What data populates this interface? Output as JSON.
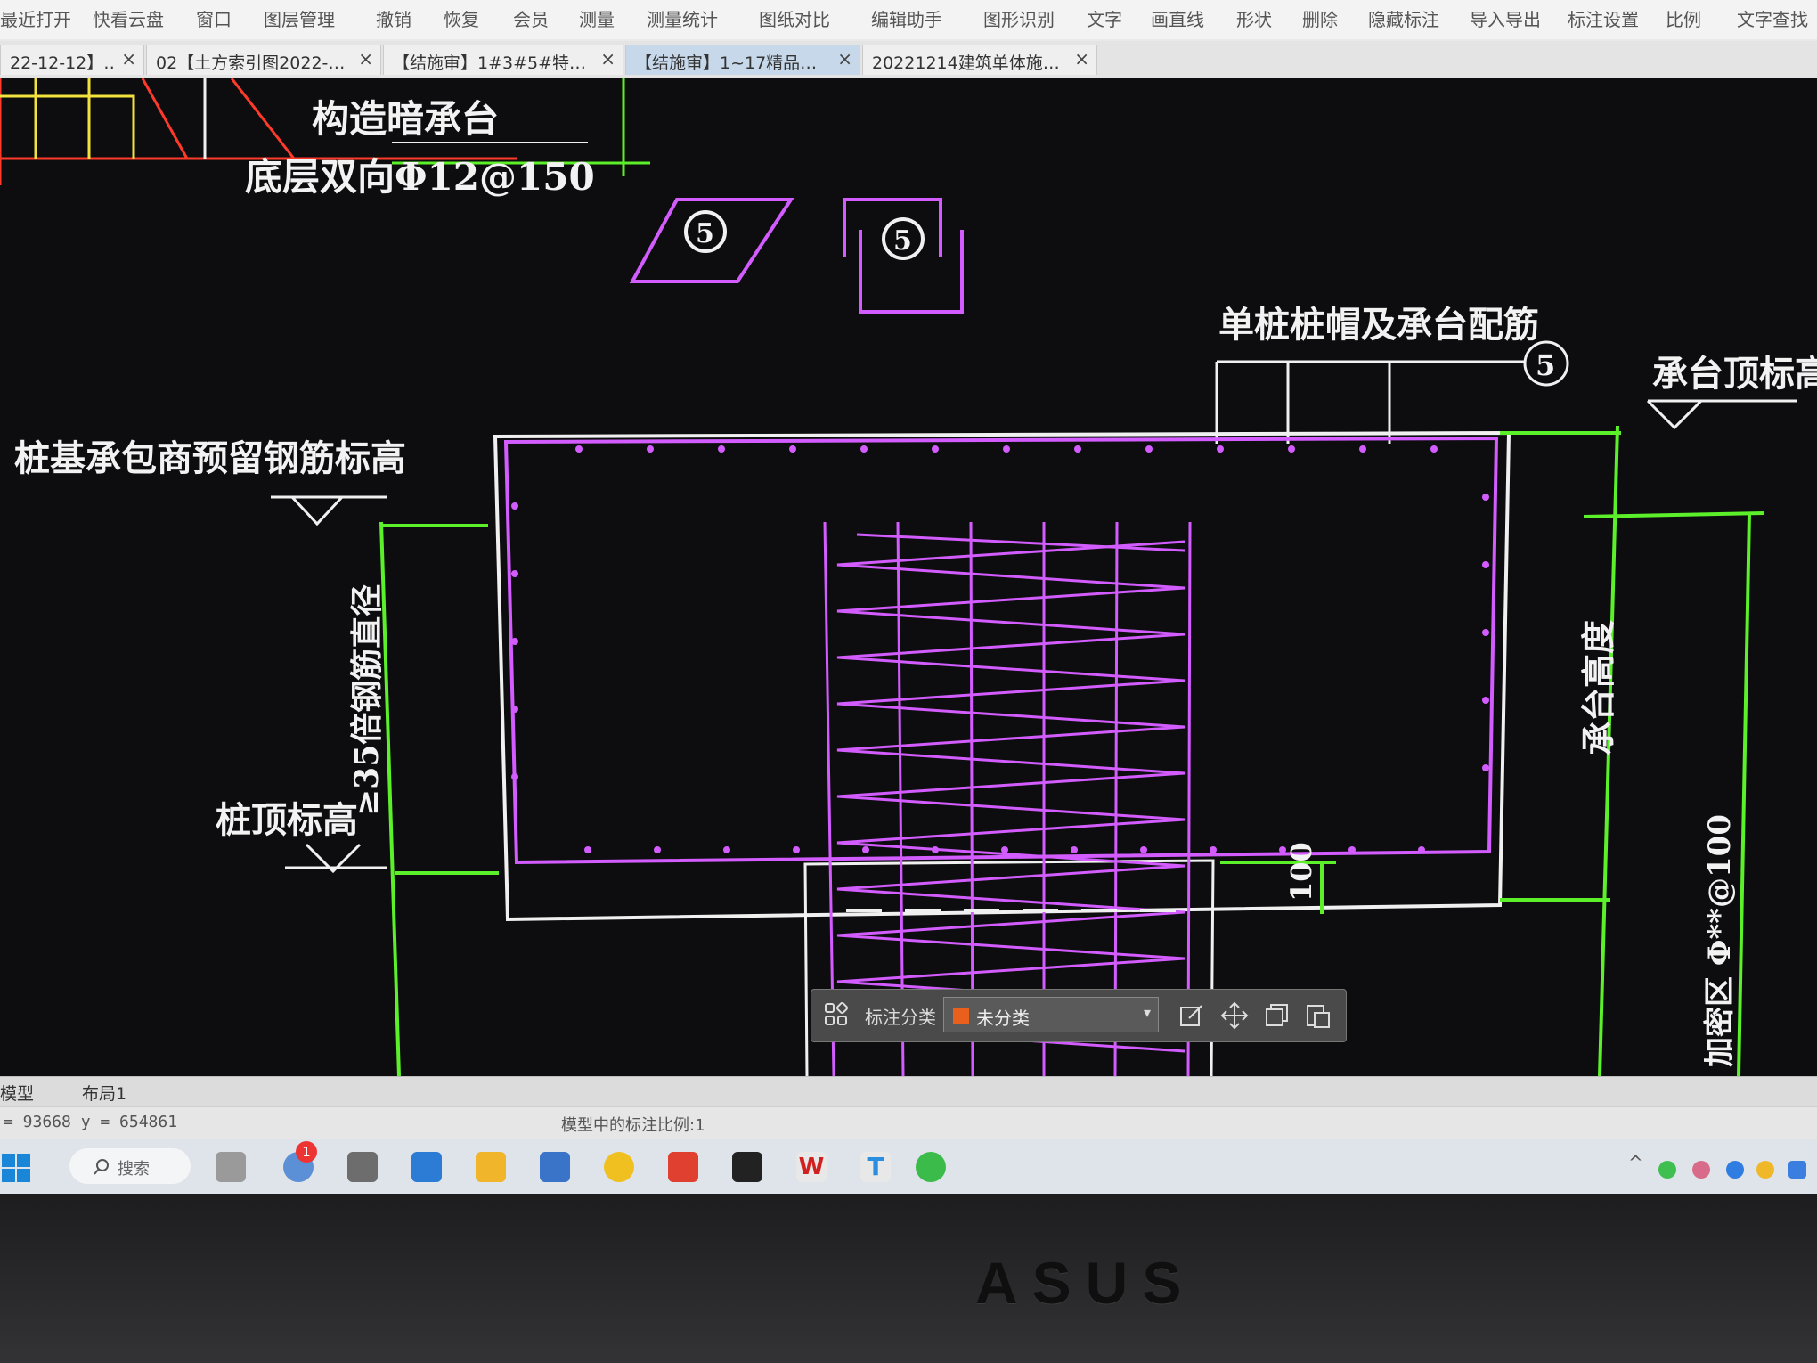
{
  "toolbar": {
    "items": [
      "最近打开",
      "快看云盘",
      "窗口",
      "图层管理",
      "撤销",
      "恢复",
      "会员",
      "测量",
      "测量统计",
      "图纸对比",
      "编辑助手",
      "图形识别",
      "文字",
      "画直线",
      "形状",
      "删除",
      "隐藏标注",
      "导入导出",
      "标注设置",
      "比例",
      "文字查找"
    ]
  },
  "tabs": [
    {
      "label": "22-12-12】…"
    },
    {
      "label": "02【土方索引图2022-…"
    },
    {
      "label": "【结施审】1#3#5#特…"
    },
    {
      "label": "【结施审】1~17精品…"
    },
    {
      "label": "20221214建筑单体施…"
    }
  ],
  "tab_close_glyph": "×",
  "drawing": {
    "texts": {
      "t1": "构造暗承台",
      "t2": "底层双向Φ12@150",
      "t3": "单桩桩帽及承台配筋",
      "t4": "承台顶标高",
      "t5": "桩基承包商预留钢筋标高",
      "t6": "≥35倍钢筋直径",
      "t7": "桩顶标高",
      "t8": "承台高度",
      "t9": "100",
      "t10": "加密区 Φ**@100",
      "sec1": "5",
      "sec2": "5",
      "sec3": "5"
    }
  },
  "annotation_bar": {
    "label": "标注分类",
    "category": "未分类",
    "category_color": "#e8601c"
  },
  "layout_tabs": [
    "模型",
    "布局1"
  ],
  "status": {
    "coords": "= 93668 y = 654861",
    "scale": "模型中的标注比例:1"
  },
  "taskbar": {
    "search_label": "搜索",
    "notification_badge": "1"
  },
  "bezel": {
    "brand": "ASUS"
  },
  "colors": {
    "magenta": "#d35cff",
    "green": "#5bf02a",
    "white": "#f0f0f0",
    "red": "#ff3a2a",
    "yellow": "#f2e23c"
  }
}
